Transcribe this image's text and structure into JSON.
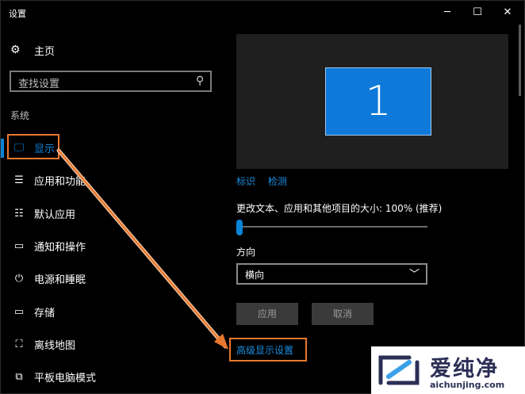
{
  "window": {
    "title": "设置",
    "controls": {
      "minimize": "─",
      "maximize": "☐",
      "close": "✕"
    }
  },
  "sidebar": {
    "home": {
      "icon": "gear-icon",
      "label": "主页"
    },
    "search": {
      "placeholder": "查找设置",
      "icon": "search-icon"
    },
    "section": "系统",
    "items": [
      {
        "icon": "monitor-icon",
        "glyph": "🖵",
        "label": "显示",
        "active": true
      },
      {
        "icon": "apps-list-icon",
        "glyph": "☰",
        "label": "应用和功能"
      },
      {
        "icon": "default-apps-icon",
        "glyph": "☷",
        "label": "默认应用"
      },
      {
        "icon": "notification-icon",
        "glyph": "▭",
        "label": "通知和操作"
      },
      {
        "icon": "power-icon",
        "glyph": "⏻",
        "label": "电源和睡眠"
      },
      {
        "icon": "storage-icon",
        "glyph": "▭",
        "label": "存储"
      },
      {
        "icon": "offline-map-icon",
        "glyph": "⛶",
        "label": "离线地图"
      },
      {
        "icon": "tablet-mode-icon",
        "glyph": "⧉",
        "label": "平板电脑模式"
      }
    ]
  },
  "main": {
    "monitor_number": "1",
    "links": {
      "identify": "标识",
      "detect": "检测"
    },
    "scale": {
      "label": "更改文本、应用和其他项目的大小: 100% (推荐)",
      "value_percent": 100,
      "slider_fraction": 0
    },
    "orientation": {
      "label": "方向",
      "value": "横向",
      "chevron": "﹀"
    },
    "buttons": {
      "apply": "应用",
      "cancel": "取消"
    },
    "advanced_link": "高级显示设置"
  },
  "annotation": {
    "color": "#e8782e"
  },
  "watermark": {
    "title": "爱纯净",
    "url": "aichunjing.com"
  },
  "colors": {
    "accent": "#0a84d8",
    "link": "#1a8ee0",
    "background": "#000000"
  }
}
